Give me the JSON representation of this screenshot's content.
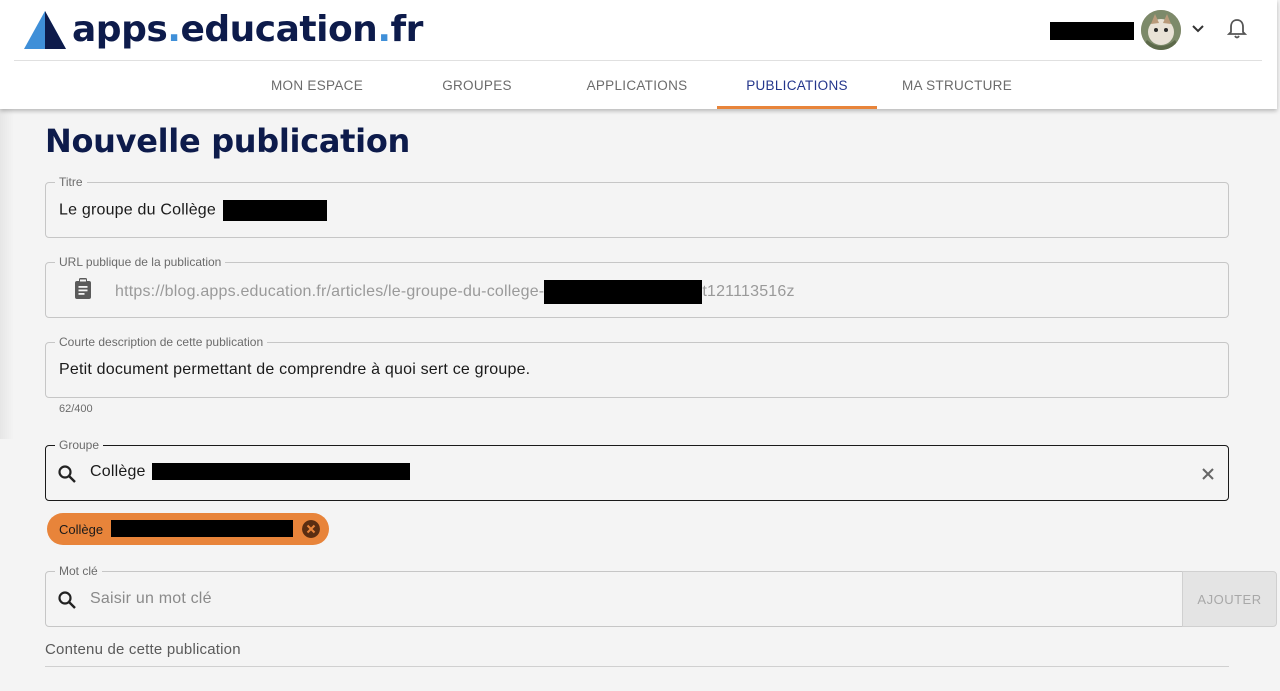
{
  "app": {
    "logo_part1": "apps",
    "logo_part2": "education",
    "logo_part3": "fr"
  },
  "nav": {
    "items": [
      {
        "label": "MON ESPACE"
      },
      {
        "label": "GROUPES"
      },
      {
        "label": "APPLICATIONS"
      },
      {
        "label": "PUBLICATIONS"
      },
      {
        "label": "MA STRUCTURE"
      }
    ],
    "active": "PUBLICATIONS"
  },
  "page": {
    "title": "Nouvelle publication"
  },
  "form": {
    "titre": {
      "label": "Titre",
      "value": "Le groupe du Collège"
    },
    "url": {
      "label": "URL publique de la publication",
      "prefix": "https://blog.apps.education.fr/articles/le-groupe-du-college-",
      "suffix": "t121113516z"
    },
    "description": {
      "label": "Courte description de cette publication",
      "value": "Petit document permettant de comprendre à quoi sert ce groupe.",
      "counter": "62/400"
    },
    "groupe": {
      "label": "Groupe",
      "value": "Collège",
      "chip_label": "Collège"
    },
    "mot_cle": {
      "label": "Mot clé",
      "placeholder": "Saisir un mot clé",
      "button": "AJOUTER"
    },
    "contenu_label": "Contenu de cette publication"
  },
  "colors": {
    "brand_navy": "#0d1b4b",
    "brand_blue": "#3f8fd8",
    "accent_orange": "#e8843a",
    "active_nav": "#23358b"
  },
  "icons": [
    "clipboard-icon",
    "search-icon",
    "close-icon",
    "chip-remove-icon",
    "chevron-down-icon",
    "bell-icon"
  ]
}
